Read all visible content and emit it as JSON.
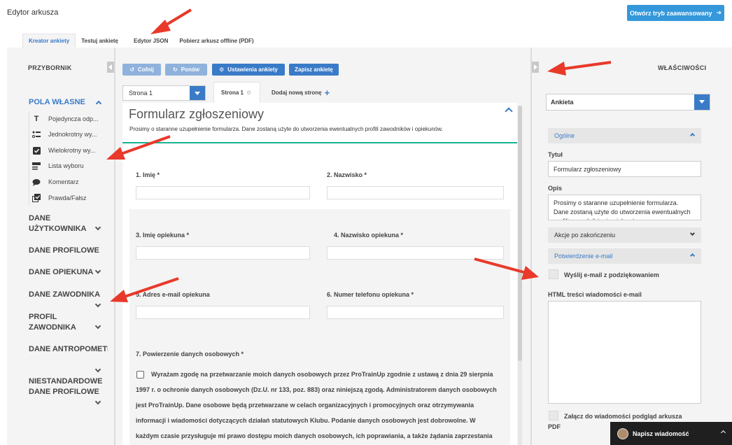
{
  "header": {
    "app_title": "Edytor arkusza",
    "advanced_button": "Otwórz tryb zaawansowany"
  },
  "tabs": [
    {
      "label": "Kreator ankiety",
      "active": true
    },
    {
      "label": "Testuj ankietę",
      "active": false
    },
    {
      "label": "Edytor JSON",
      "active": false
    },
    {
      "label": "Pobierz arkusz offline (PDF)",
      "active": false
    }
  ],
  "toolbox": {
    "title": "PRZYBORNIK",
    "categories": [
      {
        "label": "POLA WŁASNE",
        "expanded": true
      },
      {
        "label": "DANE UŻYTKOWNIKA"
      },
      {
        "label": "DANE PROFILOWE"
      },
      {
        "label": "DANE OPIEKUNA"
      },
      {
        "label": "DANE ZAWODNIKA"
      },
      {
        "label": "PROFIL ZAWODNIKA"
      },
      {
        "label": "DANE ANTROPOMETRYCZN"
      },
      {
        "label": "NIESTANDARDOWE DANE PROFILOWE"
      }
    ],
    "items": [
      {
        "label": "Pojedyncza odp...",
        "icon": "text-icon"
      },
      {
        "label": "Jednokrotny wy...",
        "icon": "radio-list-icon"
      },
      {
        "label": "Wielokrotny wy...",
        "icon": "checkbox-icon"
      },
      {
        "label": "Lista wyboru",
        "icon": "dropdown-icon"
      },
      {
        "label": "Komentarz",
        "icon": "comment-icon"
      },
      {
        "label": "Prawda/Fałsz",
        "icon": "boolean-icon"
      }
    ]
  },
  "editor": {
    "toolbar": {
      "undo": "Cofnij",
      "redo": "Ponów",
      "settings": "Ustawienia ankiety",
      "save": "Zapisz ankietę"
    },
    "page_select": "Strona 1",
    "page_tab": "Strona 1",
    "add_page": "Dodaj nową stronę",
    "form_title": "Formularz zgłoszeniowy",
    "form_description": "Prosimy o staranne uzupełnienie formularza. Dane zostaną użyte do utworzenia ewentualnych profili zawodników i opiekunów.",
    "questions": [
      {
        "label": "1. Imię *"
      },
      {
        "label": "2. Nazwisko *"
      },
      {
        "label": "3. Imię opiekuna *"
      },
      {
        "label": "4. Nazwisko opiekuna *"
      },
      {
        "label": "5. Adres e-mail opiekuna"
      },
      {
        "label": "6. Numer telefonu opiekuna *"
      },
      {
        "label": "7. Powierzenie danych osobowych *"
      }
    ],
    "consent_text": "Wyrażam zgodę na przetwarzanie moich danych osobowych przez ProTrainUp zgodnie z ustawą z dnia 29 sierpnia 1997 r. o ochronie danych osobowych (Dz.U. nr 133, poz. 883) oraz niniejszą zgodą. Administratorem danych osobowych jest ProTrainUp. Dane osobowe będą przetwarzane w celach organizacyjnych i promocyjnych oraz otrzymywania informacji i wiadomości dotyczących działań statutowych Klubu. Podanie danych osobowych jest dobrowolne. W każdym czasie przysługuje mi prawo dostępu moich danych osobowych, ich poprawiania, a także żądania zaprzestania dalszego przetwarzania danych osobowych."
  },
  "properties": {
    "title": "WŁAŚCIWOŚCI",
    "object_select": "Ankieta",
    "sections": {
      "general": "Ogólne",
      "after_complete": "Akcje po zakończeniu",
      "email": "Potwierdzenie e-mail"
    },
    "title_label": "Tytuł",
    "title_value": "Formularz zgłoszeniowy",
    "desc_label": "Opis",
    "desc_value": "Prosimy o staranne uzupełnienie formularza. Dane zostaną użyte do utworzenia ewentualnych profili zawodników i opiekunów.",
    "send_email_label": "Wyślij e-mail z podziękowaniem",
    "html_label": "HTML treści wiadomości e-mail",
    "attach_label": "Załącz do wiadomości podgląd arkusza",
    "attach_label_2": "PDF"
  },
  "chat": {
    "label": "Napisz wiadomość"
  },
  "colors": {
    "accent": "#3a7bc8",
    "accent_light": "#8fb2dd",
    "green_line": "#1ab394",
    "arrow": "#e8392a"
  }
}
